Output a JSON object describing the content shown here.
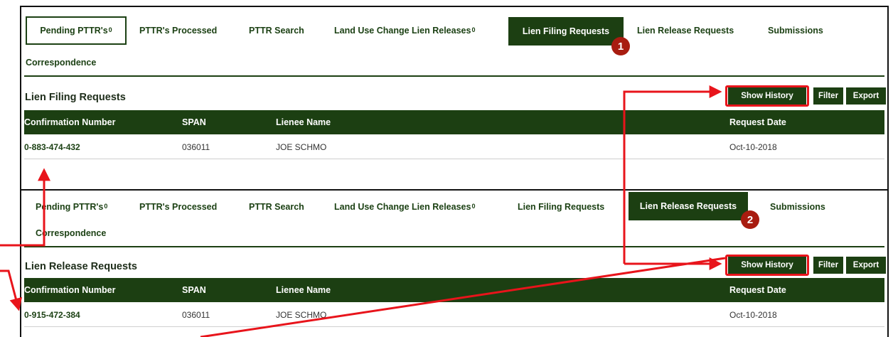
{
  "panel1": {
    "tabs": [
      {
        "label": "Pending PTTR's",
        "sup": "0"
      },
      {
        "label": "PTTR's Processed",
        "sup": ""
      },
      {
        "label": "PTTR Search",
        "sup": ""
      },
      {
        "label": "Land Use Change Lien Releases",
        "sup": "0"
      },
      {
        "label": "Lien Filing Requests",
        "sup": ""
      },
      {
        "label": "Lien Release Requests",
        "sup": ""
      },
      {
        "label": "Submissions",
        "sup": ""
      },
      {
        "label": "Correspondence",
        "sup": ""
      }
    ],
    "section_title": "Lien Filing Requests",
    "buttons": {
      "show_history": "Show History",
      "filter": "Filter",
      "export": "Export"
    },
    "columns": [
      "Confirmation Number",
      "SPAN",
      "Lienee Name",
      "Request Date"
    ],
    "rows": [
      [
        "0-883-474-432",
        "036011",
        "JOE SCHMO",
        "Oct-10-2018"
      ]
    ],
    "badge": "1"
  },
  "panel2": {
    "tabs": [
      {
        "label": "Pending PTTR's",
        "sup": "0"
      },
      {
        "label": "PTTR's Processed",
        "sup": ""
      },
      {
        "label": "PTTR Search",
        "sup": ""
      },
      {
        "label": "Land Use Change Lien Releases",
        "sup": "0"
      },
      {
        "label": "Lien Filing Requests",
        "sup": ""
      },
      {
        "label": "Lien Release Requests",
        "sup": ""
      },
      {
        "label": "Submissions",
        "sup": ""
      },
      {
        "label": "Correspondence",
        "sup": ""
      }
    ],
    "section_title": "Lien Release Requests",
    "buttons": {
      "show_history": "Show History",
      "filter": "Filter",
      "export": "Export"
    },
    "columns": [
      "Confirmation Number",
      "SPAN",
      "Lienee Name",
      "Request Date"
    ],
    "rows": [
      [
        "0-915-472-384",
        "036011",
        "JOE SCHMO",
        "Oct-10-2018"
      ]
    ],
    "badge": "2"
  },
  "colors": {
    "brand_green": "#1c3f12",
    "annotation_red": "#e8141b",
    "badge_red": "#a81c10"
  }
}
